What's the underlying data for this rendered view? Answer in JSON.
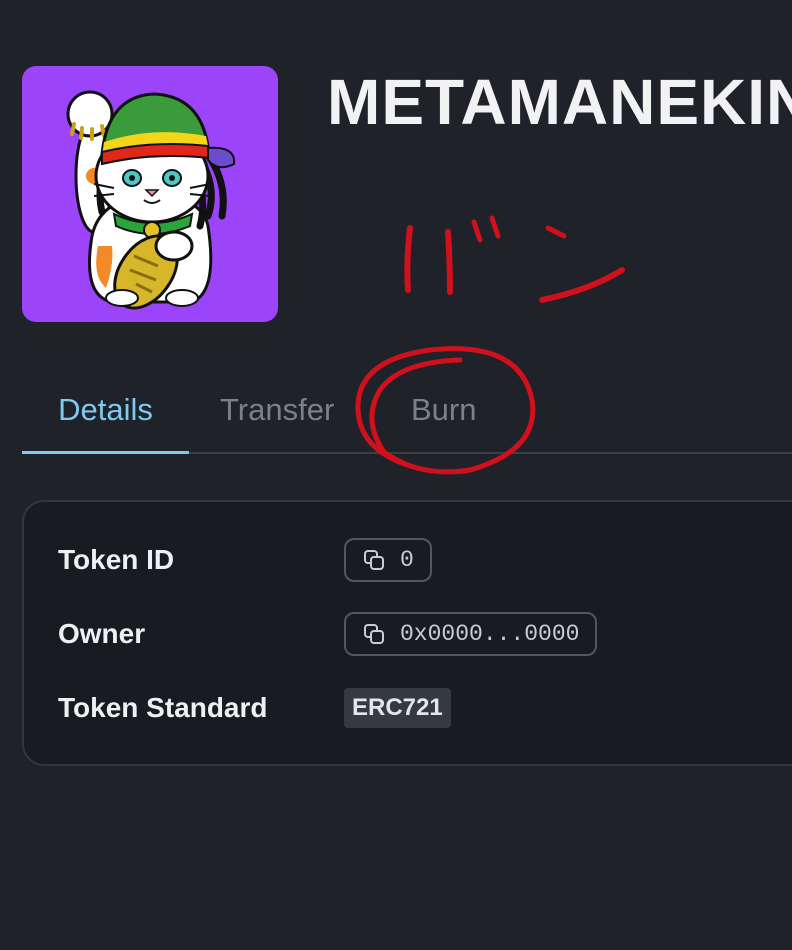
{
  "nft": {
    "title": "METAMANEKIN",
    "image_alt": "Maneki-neko cat with rasta cap holding a gold koban coin",
    "image_bg": "#9b44fa"
  },
  "tabs": [
    {
      "label": "Details",
      "active": true
    },
    {
      "label": "Transfer",
      "active": false
    },
    {
      "label": "Burn",
      "active": false
    }
  ],
  "details": {
    "token_id_label": "Token ID",
    "token_id_value": "0",
    "owner_label": "Owner",
    "owner_value": "0x0000...0000",
    "standard_label": "Token Standard",
    "standard_value": "ERC721"
  },
  "annotation": {
    "handwritten_text": "バン",
    "color": "#d0101c"
  },
  "colors": {
    "background": "#1f2228",
    "accent": "#7fc8ee",
    "card": "#181b20"
  }
}
